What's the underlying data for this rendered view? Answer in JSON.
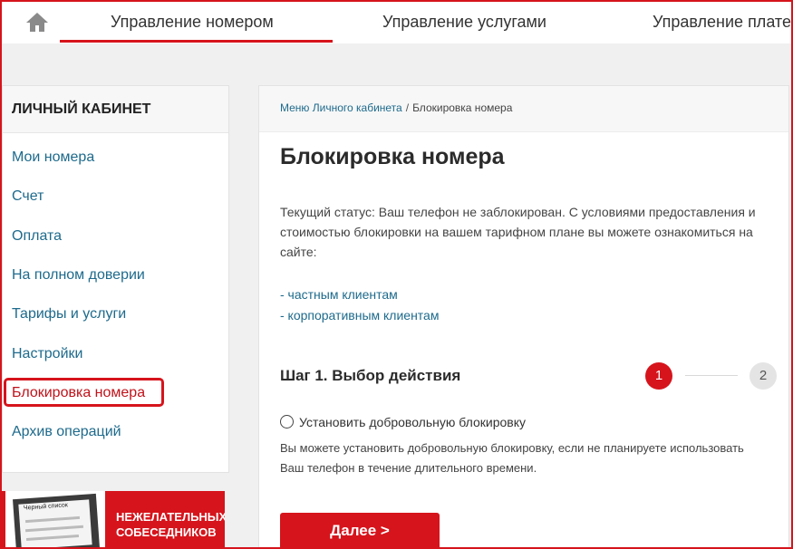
{
  "topnav": {
    "home_icon": "home-icon",
    "tabs": [
      {
        "label": "Управление номером",
        "active": true
      },
      {
        "label": "Управление услугами",
        "active": false
      },
      {
        "label": "Управление плате",
        "active": false
      }
    ]
  },
  "sidebar": {
    "title": "ЛИЧНЫЙ КАБИНЕТ",
    "items": [
      {
        "label": "Мои номера"
      },
      {
        "label": "Счет"
      },
      {
        "label": "Оплата"
      },
      {
        "label": "На полном доверии"
      },
      {
        "label": "Тарифы и услуги"
      },
      {
        "label": "Настройки"
      },
      {
        "label": "Блокировка номера",
        "active": true
      },
      {
        "label": "Архив операций"
      }
    ]
  },
  "banner": {
    "image_title": "Черный список",
    "text_line1": "НЕЖЕЛАТЕЛЬНЫХ",
    "text_line2": "СОБЕСЕДНИКОВ"
  },
  "main": {
    "breadcrumb": {
      "parent": "Меню Личного кабинета",
      "separator": "/",
      "current": "Блокировка номера"
    },
    "title": "Блокировка номера",
    "status_text": "Текущий статус: Ваш телефон не заблокирован. С условиями предоставления и стоимостью блокировки на вашем тарифном плане вы можете ознакомиться на сайте:",
    "links": {
      "private": "- частным клиентам",
      "corporate": "- корпоративным клиентам"
    },
    "step": {
      "title": "Шаг 1. Выбор действия",
      "current": "1",
      "next": "2"
    },
    "option": {
      "label": "Установить добровольную блокировку",
      "selected": false
    },
    "description": {
      "line1": "Вы можете установить добровольную блокировку, если не планируете использовать",
      "line2": "Ваш телефон в течение длительного времени."
    },
    "next_button": "Далее >"
  },
  "colors": {
    "accent": "#d6141c",
    "link": "#1d6a8c",
    "background": "#f0f0f0"
  }
}
